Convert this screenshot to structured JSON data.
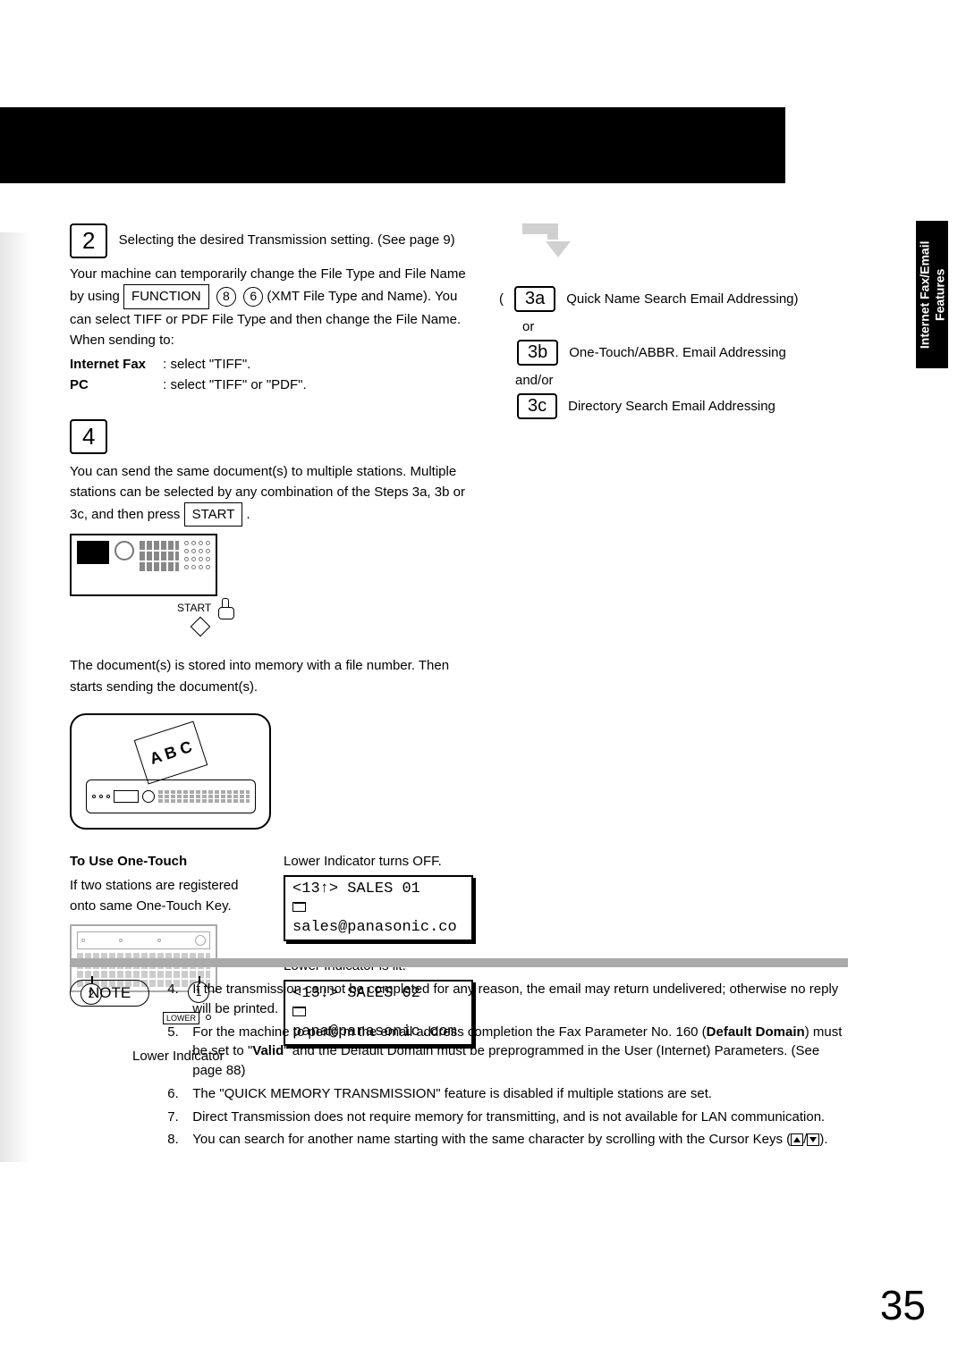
{
  "sideTab": {
    "line1": "Internet Fax/Email",
    "line2": "Features"
  },
  "step2": {
    "num": "2",
    "title": "Selecting the desired Transmission setting. (See page 9)",
    "p1a": "Your machine can temporarily change the File Type and File Name by using ",
    "func": "FUNCTION",
    "d8": "8",
    "d6": "6",
    "p1b": " (XMT File Type and Name). You can select TIFF or PDF File Type and then change the File Name. When sending to:",
    "lbl1": "Internet Fax",
    "val1": ":   select \"TIFF\".",
    "lbl2": "PC",
    "val2": ":   select \"TIFF\" or \"PDF\"."
  },
  "step4": {
    "num": "4",
    "p1": "You can send the same document(s) to multiple stations. Multiple stations can be selected by any combination of the Steps 3a, 3b or 3c, and then press ",
    "start": "START",
    "startCap": "START",
    "p2": "The document(s) is stored into memory with a file number. Then starts sending the document(s).",
    "sheetText": "A B C"
  },
  "oneTouch": {
    "title": "To Use One-Touch",
    "desc": "If two stations are registered onto same One-Touch Key.",
    "c1": "2",
    "c2": "1",
    "lowerBox": "LOWER",
    "lowerLabel": "Lower Indicator",
    "rA": "Lower Indicator turns OFF.",
    "dispA1": "<13↑> SALES 01",
    "dispA2": "sales@panasonic.co",
    "rB": "Lower Indicator is lit.",
    "dispB1": "<13↓> SALES 02",
    "dispB2": "pana@panasonic.com"
  },
  "right": {
    "s3a": "3a",
    "t3a": "Quick Name Search Email Addressing)",
    "or": "or",
    "s3b": "3b",
    "t3b": "One-Touch/ABBR. Email Addressing",
    "andor": "and/or",
    "s3c": "3c",
    "t3c": "Directory Search Email Addressing"
  },
  "note": {
    "label": "NOTE",
    "items": [
      {
        "n": "4.",
        "t": "If the transmission cannot be completed for any reason, the email may return undelivered; otherwise no reply will be printed."
      },
      {
        "n": "5.",
        "t": "For the machine to perform the email address completion the Fax Parameter No. 160 (Default Domain) must be set to \"Valid\" and the Default Domain must be preprogrammed in the User (Internet) Parameters. (See page 88)",
        "bold1": "Default Domain",
        "bold2": "Valid"
      },
      {
        "n": "6.",
        "t": "The \"QUICK MEMORY TRANSMISSION\" feature is disabled if multiple stations are set."
      },
      {
        "n": "7.",
        "t": "Direct Transmission does not require memory for transmitting, and is not available for LAN communication."
      },
      {
        "n": "8.",
        "t": "You can search for another name starting with the same character by scrolling with the Cursor Keys (",
        "tail": ")."
      }
    ]
  },
  "pageNum": "35"
}
